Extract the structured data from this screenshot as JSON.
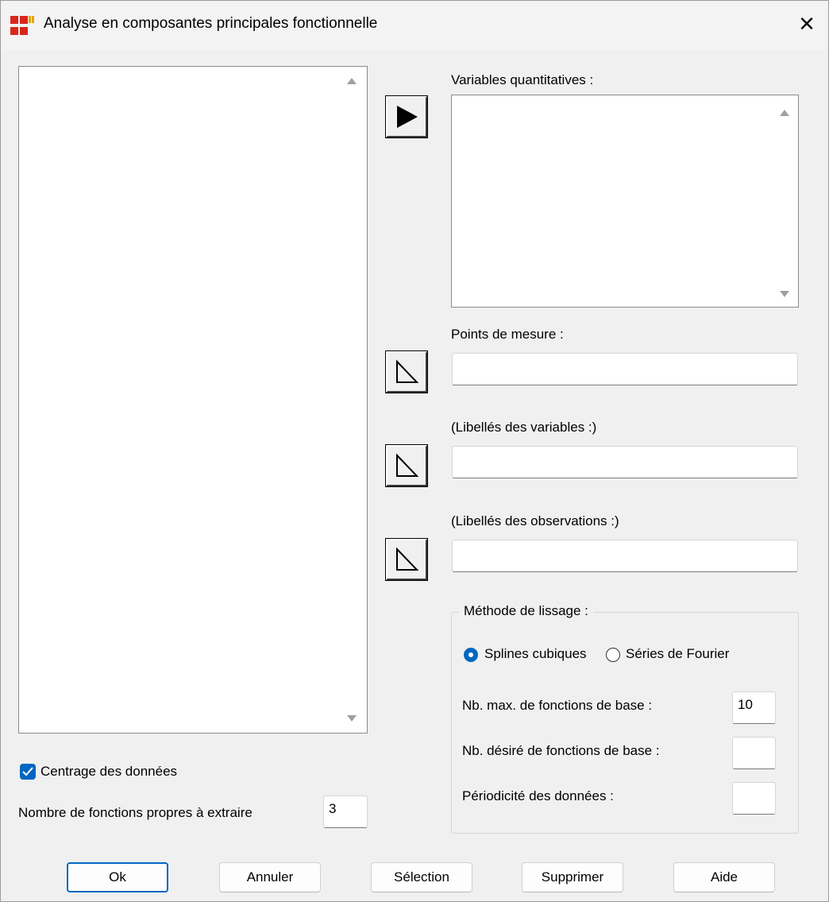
{
  "window": {
    "title": "Analyse en composantes principales fonctionnelle",
    "close_glyph": "✕"
  },
  "fields": {
    "variables_quantitatives": "Variables quantitatives :",
    "points_de_mesure": "Points de mesure :",
    "libelles_variables": "(Libellés des variables :)",
    "libelles_observations": "(Libellés des observations :)"
  },
  "smoothing": {
    "legend": "Méthode de lissage :",
    "options": [
      {
        "label": "Splines cubiques",
        "selected": true
      },
      {
        "label": "Séries de Fourier",
        "selected": false
      }
    ],
    "max_basis_label": "Nb. max. de fonctions de base :",
    "max_basis_value": "10",
    "desired_basis_label": "Nb. désiré de fonctions de base :",
    "desired_basis_value": "",
    "periodicity_label": "Périodicité des données :",
    "periodicity_value": ""
  },
  "options": {
    "centering_label": "Centrage des données",
    "centering_checked": true,
    "num_functions_label": "Nombre de fonctions propres à extraire",
    "num_functions_value": "3"
  },
  "buttons": {
    "ok": "Ok",
    "cancel": "Annuler",
    "selection": "Sélection",
    "delete": "Supprimer",
    "help": "Aide"
  },
  "colors": {
    "accent": "#0067c0",
    "background": "#f0f0f0"
  },
  "icons": [
    "app-icon",
    "close-icon",
    "move-right-filled-icon",
    "move-right-outline-icon",
    "check-icon"
  ]
}
